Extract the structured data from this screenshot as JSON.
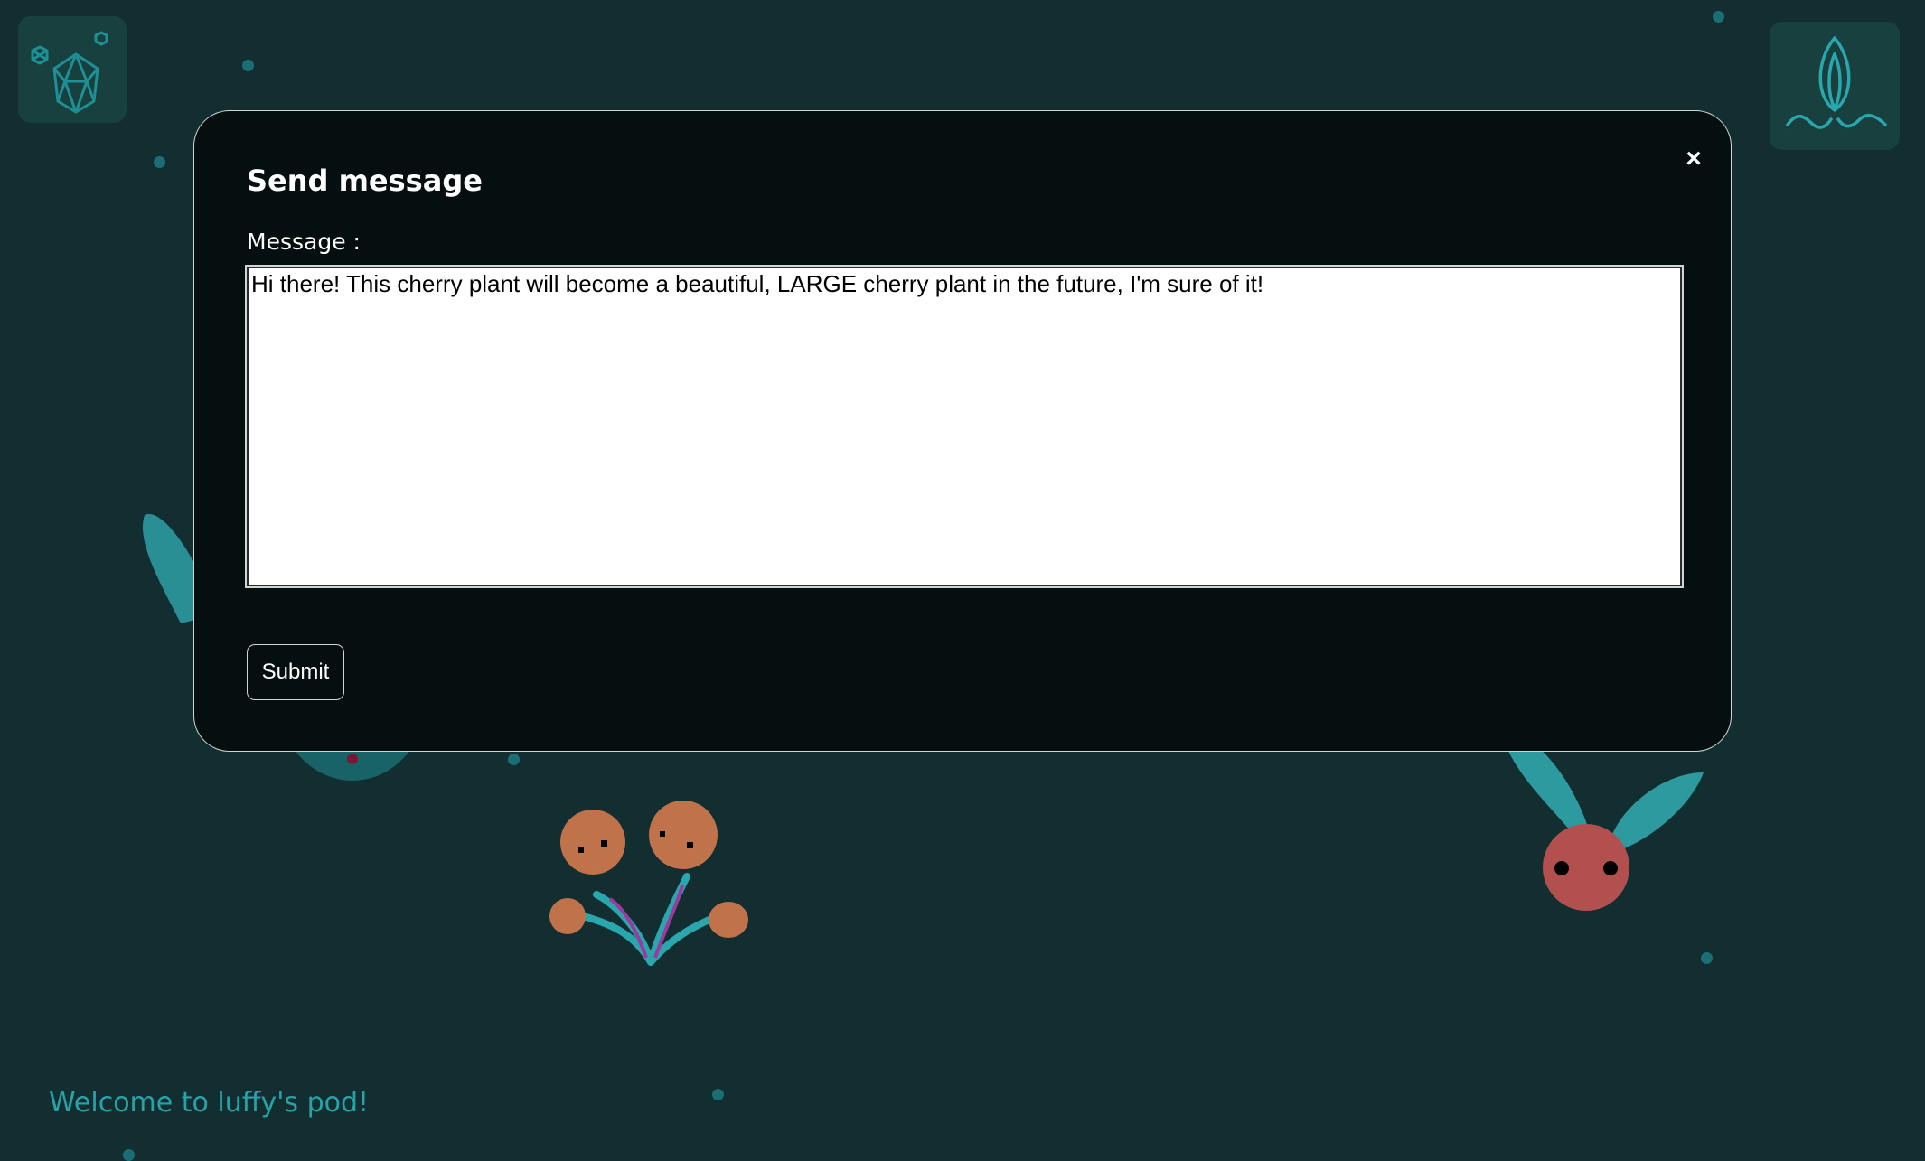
{
  "colors": {
    "background": "#132e30",
    "modal_bg": "#060f0f",
    "accent": "#27a3a8"
  },
  "icons": {
    "top_left": "crystal-gems-icon",
    "top_right": "sprout-water-icon",
    "close": "close-icon"
  },
  "modal": {
    "title": "Send message",
    "close_symbol": "×",
    "field_label": "Message :",
    "message_value": "Hi there! This cherry plant will become a beautiful, LARGE cherry plant in the future, I'm sure of it!",
    "submit_label": "Submit"
  },
  "footer": {
    "welcome_text": "Welcome to luffy's pod!"
  }
}
